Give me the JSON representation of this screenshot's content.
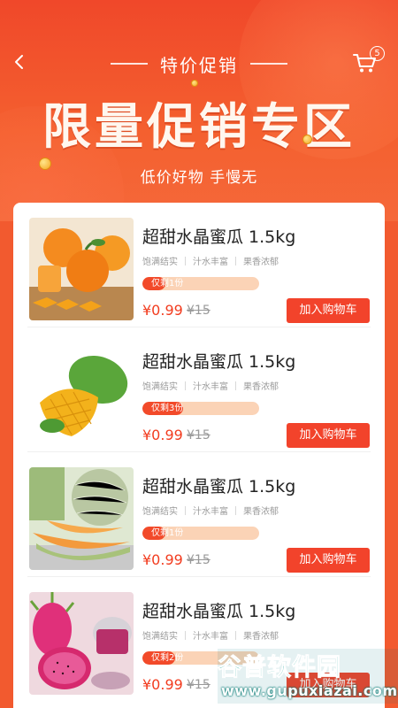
{
  "header": {
    "title": "特价促销",
    "banner_title": "限量促销专区",
    "banner_subtitle": "低价好物 手慢无",
    "cart_count": "5"
  },
  "products": [
    {
      "name": "超甜水晶蜜瓜 1.5kg",
      "tags": [
        "饱满结实",
        "汁水丰富",
        "果香浓郁"
      ],
      "stock_label": "仅剩1份",
      "stock_level": 0.2,
      "price": "¥0.99",
      "original_price": "¥15",
      "add_label": "加入购物车",
      "image": "oranges"
    },
    {
      "name": "超甜水晶蜜瓜 1.5kg",
      "tags": [
        "饱满结实",
        "汁水丰富",
        "果香浓郁"
      ],
      "stock_label": "仅剩3份",
      "stock_level": 0.35,
      "price": "¥0.99",
      "original_price": "¥15",
      "add_label": "加入购物车",
      "image": "mango"
    },
    {
      "name": "超甜水晶蜜瓜 1.5kg",
      "tags": [
        "饱满结实",
        "汁水丰富",
        "果香浓郁"
      ],
      "stock_label": "仅剩1份",
      "stock_level": 0.2,
      "price": "¥0.99",
      "original_price": "¥15",
      "add_label": "加入购物车",
      "image": "melon"
    },
    {
      "name": "超甜水晶蜜瓜 1.5kg",
      "tags": [
        "饱满结实",
        "汁水丰富",
        "果香浓郁"
      ],
      "stock_label": "仅剩2份",
      "stock_level": 0.28,
      "price": "¥0.99",
      "original_price": "¥15",
      "add_label": "加入购物车",
      "image": "dragon-fruit"
    }
  ],
  "watermark": {
    "text": "谷普软件园",
    "url": "www.gupuxiazai.com"
  },
  "colors": {
    "accent": "#f2432b",
    "price": "#f23c1f"
  }
}
